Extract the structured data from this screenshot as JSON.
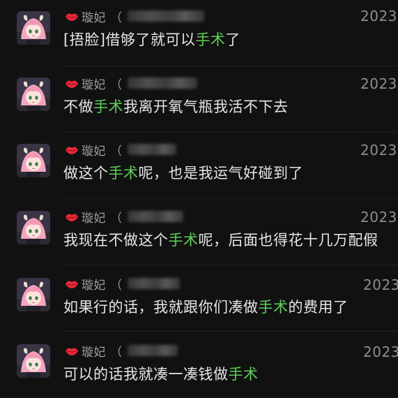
{
  "colors": {
    "background": "#111111",
    "keyword": "#5fcf5a",
    "text": "#e6e6e6",
    "meta": "#8e8e8e"
  },
  "messages": [
    {
      "icon": "lips-icon",
      "nickname": "璇妃",
      "paren": "（",
      "timestamp": "2023",
      "content": [
        "[捂脸]借够了就可以",
        "手术",
        "了"
      ]
    },
    {
      "icon": "lips-icon",
      "nickname": "璇妃",
      "paren": "（",
      "timestamp": "2023",
      "content": [
        "不做",
        "手术",
        "我离开氧气瓶我活不下去"
      ]
    },
    {
      "icon": "lips-icon",
      "nickname": "璇妃",
      "paren": "（",
      "timestamp": "2023",
      "content": [
        "做这个",
        "手术",
        "呢，也是我运气好碰到了"
      ]
    },
    {
      "icon": "lips-icon",
      "nickname": "璇妃",
      "paren": "（",
      "timestamp": "2023",
      "content": [
        "我现在不做这个",
        "手术",
        "呢，后面也得花十几万配假"
      ]
    },
    {
      "icon": "lips-icon",
      "nickname": "璇妃",
      "paren": "（",
      "timestamp": "2023",
      "content": [
        "如果行的话，我就跟你们凑做",
        "手术",
        "的费用了"
      ]
    },
    {
      "icon": "lips-icon",
      "nickname": "璇妃",
      "paren": "（",
      "timestamp": "2023",
      "content": [
        "可以的话我就凑一凑钱做",
        "手术",
        ""
      ]
    }
  ]
}
